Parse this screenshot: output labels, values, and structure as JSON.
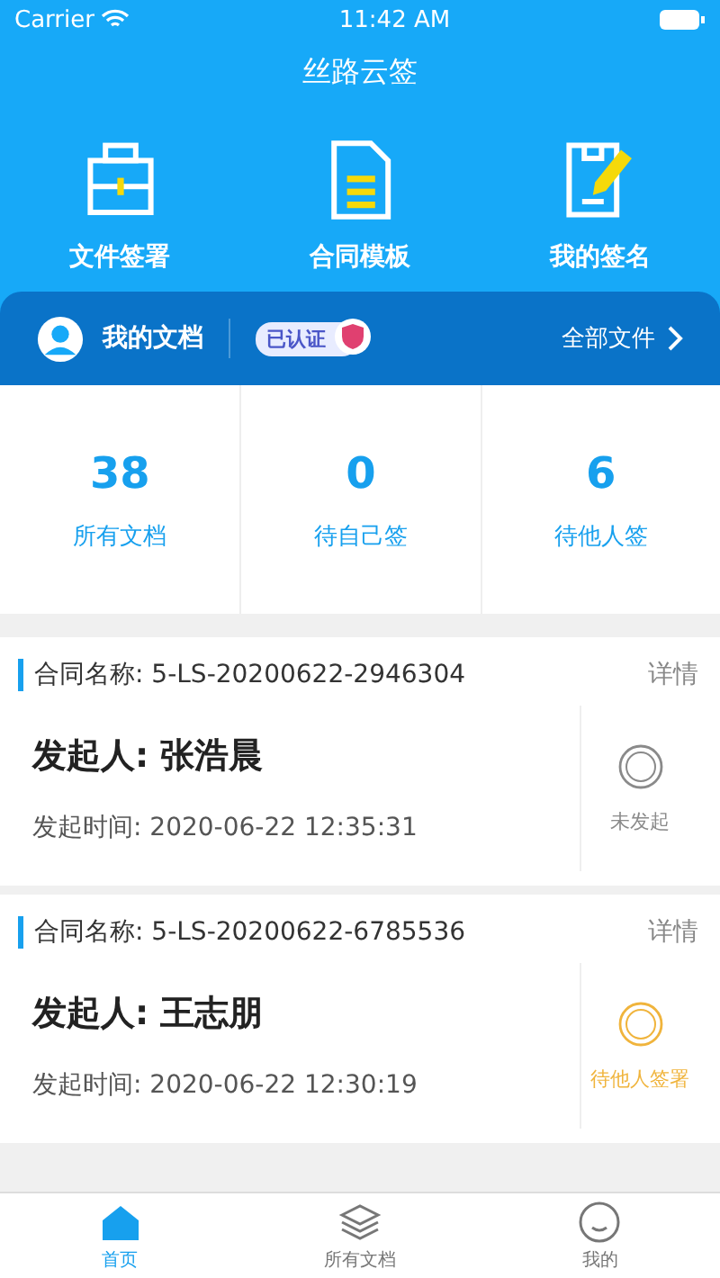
{
  "status_bar": {
    "carrier": "Carrier",
    "time": "11:42 AM"
  },
  "title": "丝路云签",
  "shortcuts": [
    {
      "label": "文件签署",
      "kind": "toolbox"
    },
    {
      "label": "合同模板",
      "kind": "document"
    },
    {
      "label": "我的签名",
      "kind": "sign"
    }
  ],
  "my_docs": {
    "label": "我的文档",
    "badge": "已认证",
    "link": "全部文件"
  },
  "stats": [
    {
      "value": "38",
      "label": "所有文档"
    },
    {
      "value": "0",
      "label": "待自己签"
    },
    {
      "value": "6",
      "label": "待他人签"
    }
  ],
  "contracts": [
    {
      "name": "合同名称: 5-LS-20200622-2946304",
      "detail": "详情",
      "initiator": "发起人: 张浩晨",
      "time": "发起时间: 2020-06-22 12:35:31",
      "status": "未发起",
      "color": "#8a8a8a"
    },
    {
      "name": "合同名称: 5-LS-20200622-6785536",
      "detail": "详情",
      "initiator": "发起人: 王志朋",
      "time": "发起时间: 2020-06-22 12:30:19",
      "status": "待他人签署",
      "color": "#f0b43c"
    }
  ],
  "tabbar": [
    {
      "label": "首页",
      "kind": "home",
      "selected": true
    },
    {
      "label": "所有文档",
      "kind": "layers",
      "selected": false
    },
    {
      "label": "我的",
      "kind": "face",
      "selected": false
    }
  ]
}
